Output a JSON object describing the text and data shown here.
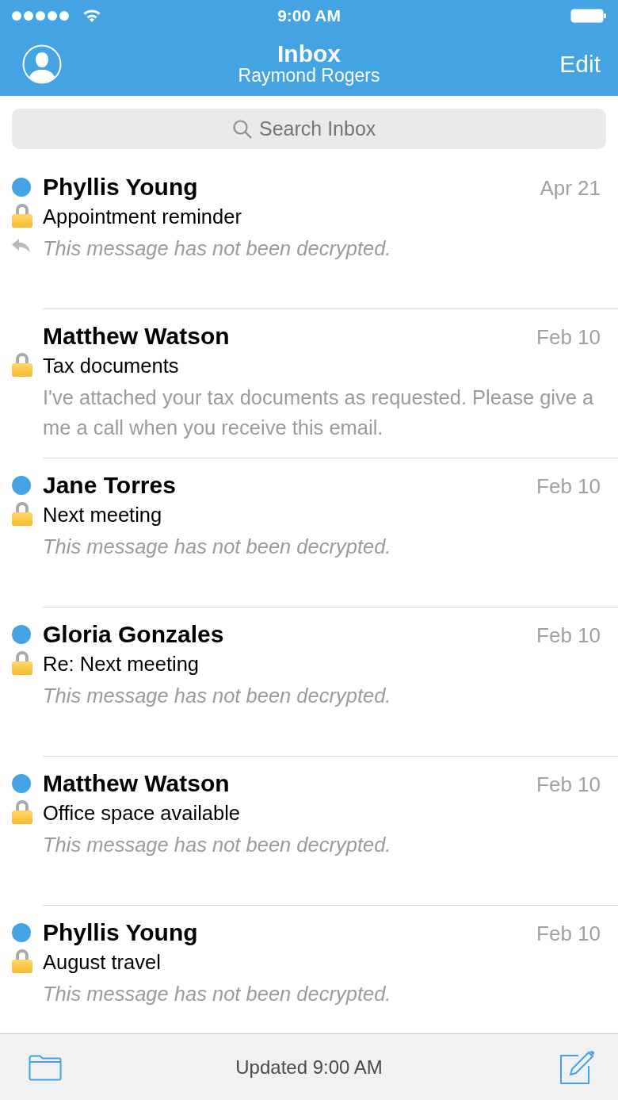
{
  "status_bar": {
    "time": "9:00 AM"
  },
  "nav": {
    "title": "Inbox",
    "subtitle": "Raymond Rogers",
    "edit": "Edit"
  },
  "search": {
    "placeholder": "Search Inbox"
  },
  "messages": [
    {
      "sender": "Phyllis Young",
      "date": "Apr 21",
      "subject": "Appointment reminder",
      "preview": "This message has not been decrypted.",
      "unread": true,
      "locked": true,
      "replied": true,
      "decrypted": false
    },
    {
      "sender": "Matthew Watson",
      "date": "Feb 10",
      "subject": "Tax documents",
      "preview": "I've attached your tax documents as requested. Please give a me a call when you receive this email.",
      "unread": false,
      "locked": true,
      "replied": false,
      "decrypted": true
    },
    {
      "sender": "Jane Torres",
      "date": "Feb 10",
      "subject": "Next meeting",
      "preview": "This message has not been decrypted.",
      "unread": true,
      "locked": true,
      "replied": false,
      "decrypted": false
    },
    {
      "sender": "Gloria Gonzales",
      "date": "Feb 10",
      "subject": "Re: Next meeting",
      "preview": "This message has not been decrypted.",
      "unread": true,
      "locked": true,
      "replied": false,
      "decrypted": false
    },
    {
      "sender": "Matthew Watson",
      "date": "Feb 10",
      "subject": "Office space available",
      "preview": "This message has not been decrypted.",
      "unread": true,
      "locked": true,
      "replied": false,
      "decrypted": false
    },
    {
      "sender": "Phyllis Young",
      "date": "Feb 10",
      "subject": "August travel",
      "preview": "This message has not been decrypted.",
      "unread": true,
      "locked": true,
      "replied": false,
      "decrypted": false
    }
  ],
  "footer": {
    "status": "Updated 9:00 AM"
  }
}
